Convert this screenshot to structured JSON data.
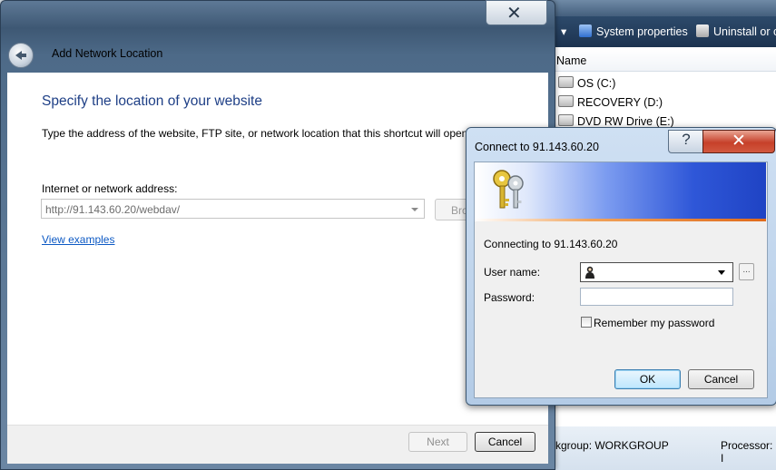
{
  "explorer": {
    "toolbar": {
      "system_properties": "System properties",
      "uninstall": "Uninstall or c"
    },
    "column_header": "Name",
    "drives": [
      {
        "label": "OS (C:)"
      },
      {
        "label": "RECOVERY (D:)"
      },
      {
        "label": "DVD RW Drive (E:)"
      }
    ],
    "status": {
      "workgroup": "kgroup:  WORKGROUP",
      "processor": "Processor:  I"
    }
  },
  "wizard": {
    "title": "Add Network Location",
    "heading": "Specify the location of your website",
    "description": "Type the address of the website, FTP site, or network location that this shortcut will open.",
    "address_label": "Internet or network address:",
    "address_value": "http://91.143.60.20/webdav/",
    "browse_label": "Bro",
    "view_examples": "View examples",
    "next_label": "Next",
    "cancel_label": "Cancel"
  },
  "connect_dialog": {
    "title": "Connect to 91.143.60.20",
    "connecting_text": "Connecting to 91.143.60.20",
    "username_label": "User name:",
    "password_label": "Password:",
    "remember_label": "Remember my password",
    "remember_checked": false,
    "ok_label": "OK",
    "cancel_label": "Cancel",
    "dots_label": "..."
  }
}
